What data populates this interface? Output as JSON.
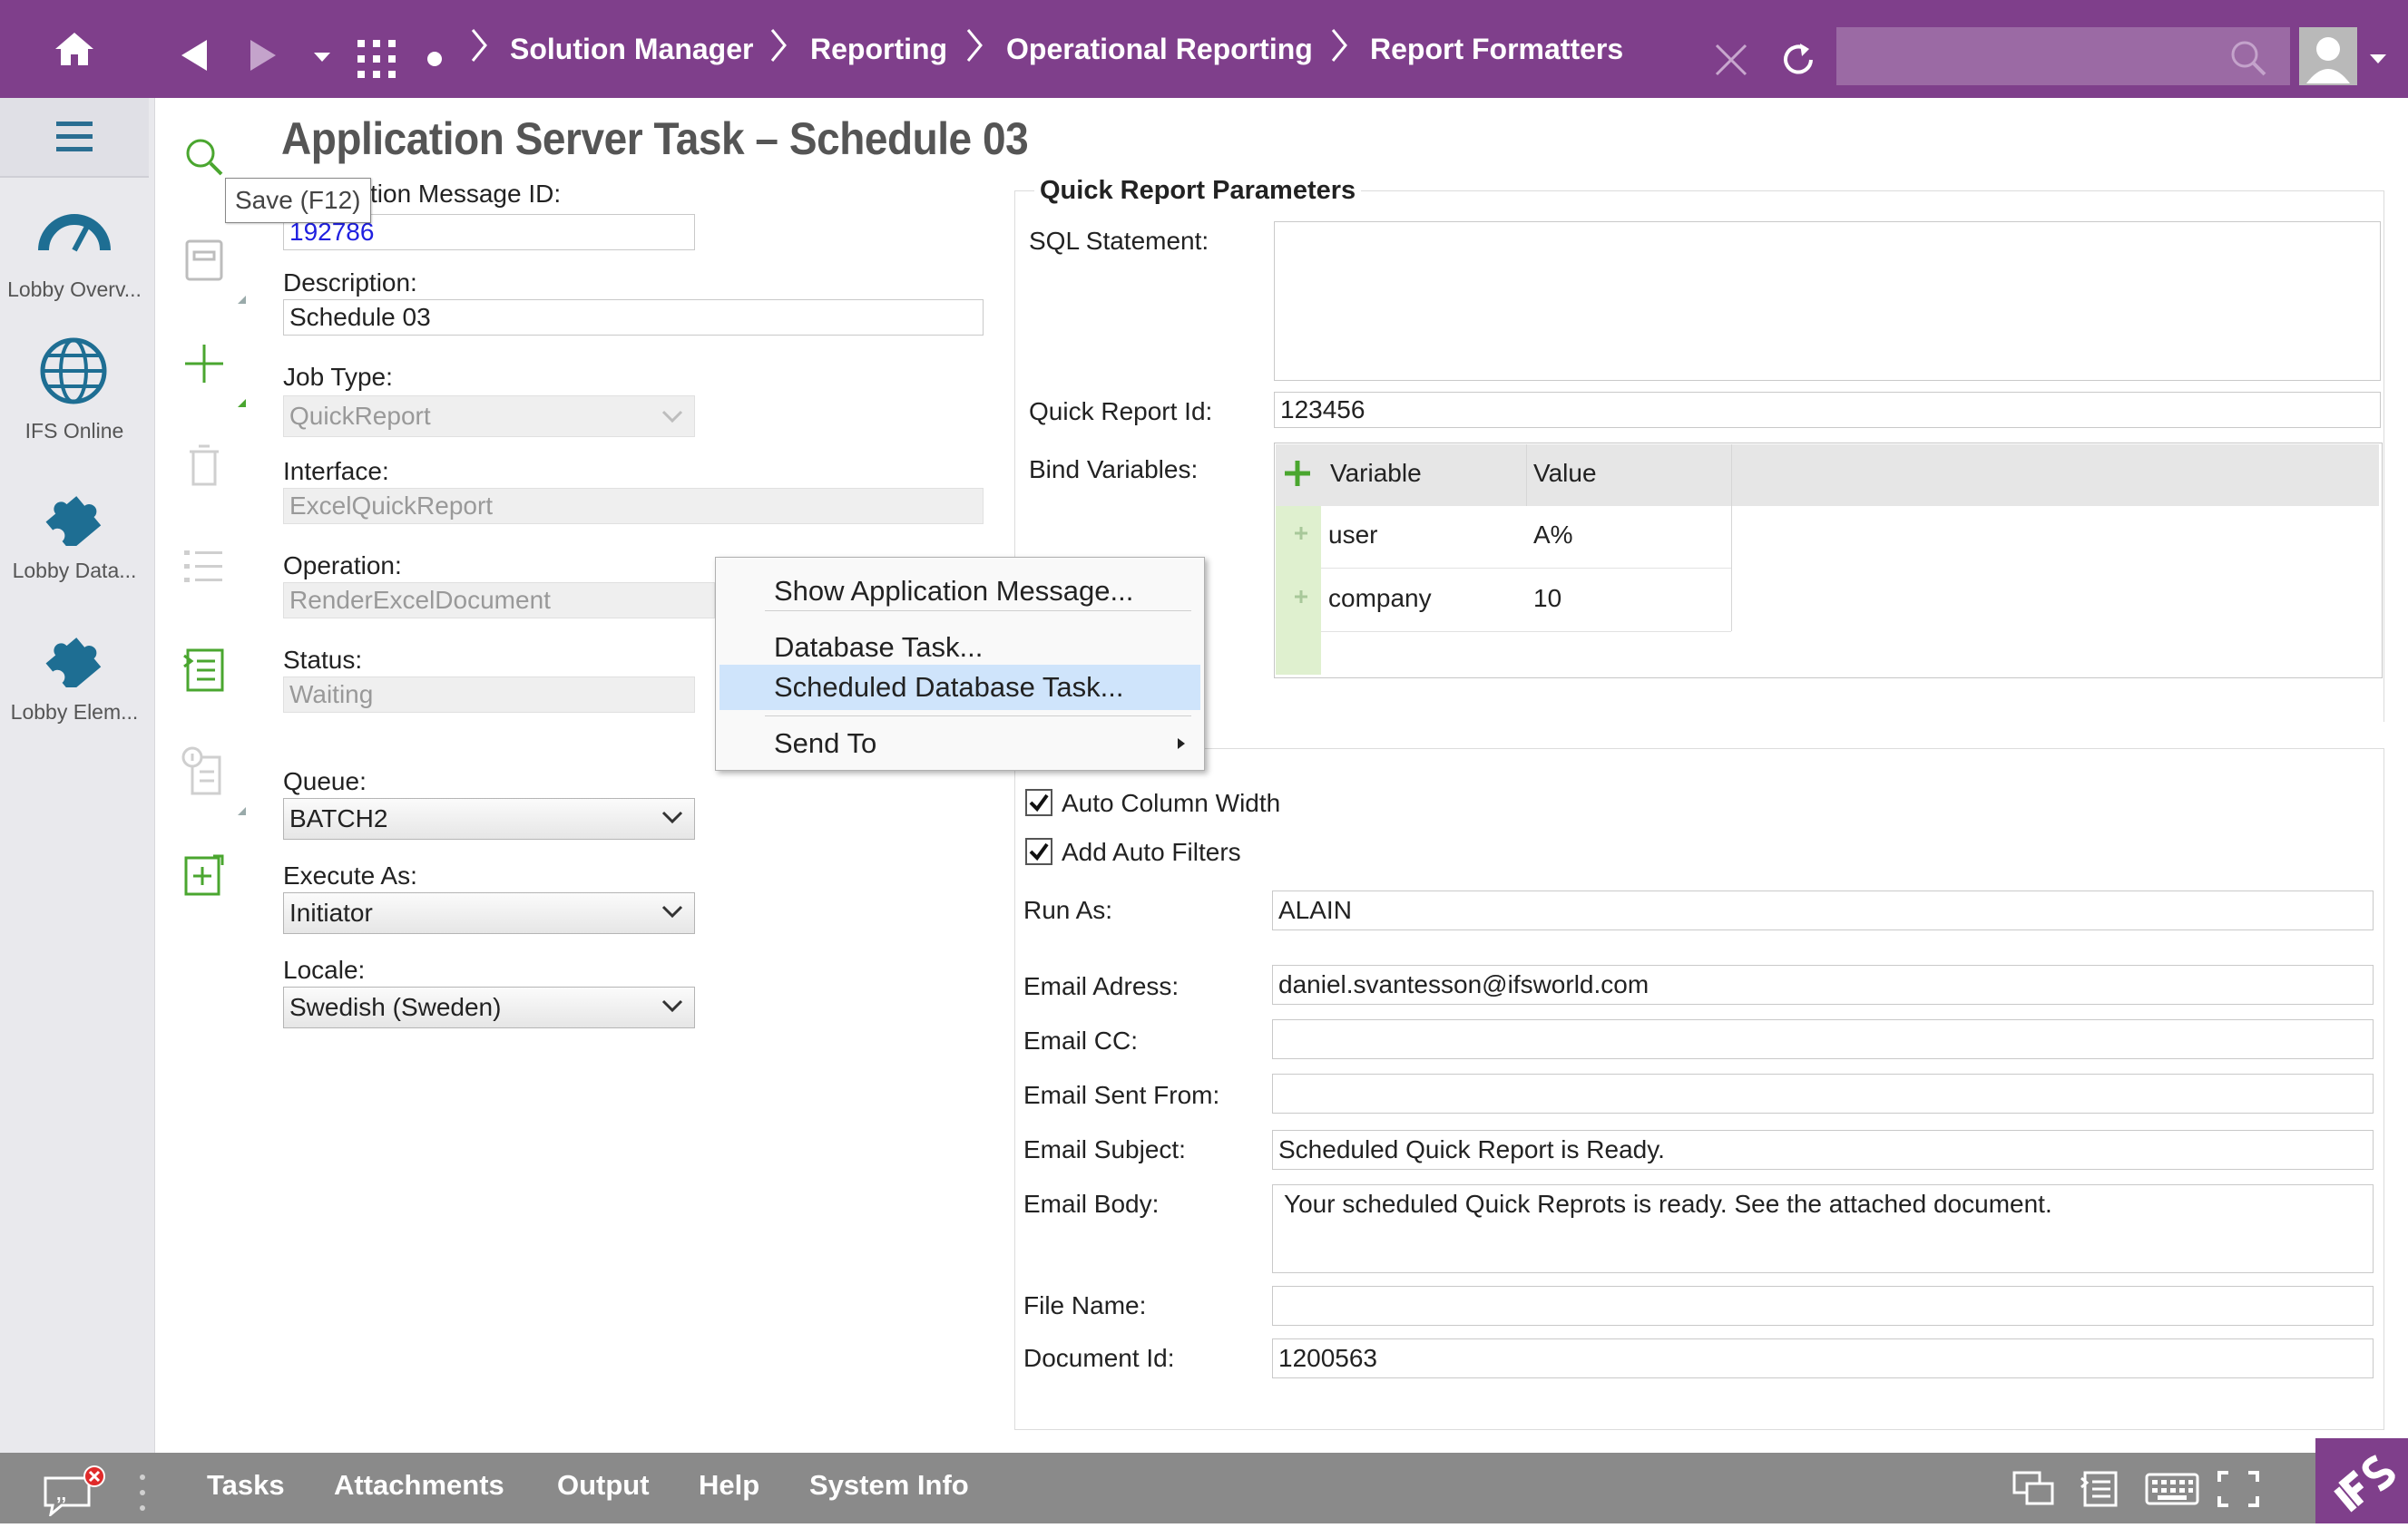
{
  "breadcrumbs": [
    "Solution Manager",
    "Reporting",
    "Operational Reporting",
    "Report Formatters"
  ],
  "sidebar": {
    "items": [
      {
        "label": "Lobby Overv..."
      },
      {
        "label": "IFS Online"
      },
      {
        "label": "Lobby Data..."
      },
      {
        "label": "Lobby Elem..."
      }
    ]
  },
  "tooltip": "Save (F12)",
  "page_title": "Application Server Task – Schedule 03",
  "form": {
    "message_id_label": "tion Message ID:",
    "message_id": "192786",
    "description_label": "Description:",
    "description": "Schedule 03",
    "job_type_label": "Job Type:",
    "job_type": "QuickReport",
    "interface_label": "Interface:",
    "interface": "ExcelQuickReport",
    "operation_label": "Operation:",
    "operation": "RenderExcelDocument",
    "status_label": "Status:",
    "status": "Waiting",
    "queue_label": "Queue:",
    "queue": "BATCH2",
    "execute_as_label": "Execute As:",
    "execute_as": "Initiator",
    "locale_label": "Locale:",
    "locale": "Swedish (Sweden)"
  },
  "quick_report": {
    "title": "Quick Report Parameters",
    "sql_label": "SQL Statement:",
    "sql": "",
    "id_label": "Quick Report Id:",
    "id": "123456",
    "bind_label": "Bind Variables:",
    "grid_headers": [
      "Variable",
      "Value"
    ],
    "grid_rows": [
      {
        "variable": "user",
        "value": "A%"
      },
      {
        "variable": "company",
        "value": "10"
      }
    ]
  },
  "options": {
    "auto_column_width": "Auto Column Width",
    "add_auto_filters": "Add Auto Filters",
    "run_as_label": "Run As:",
    "run_as": "ALAIN",
    "email_label": "Email Adress:",
    "email": "daniel.svantesson@ifsworld.com",
    "email_cc_label": "Email CC:",
    "email_cc": "",
    "email_from_label": "Email Sent From:",
    "email_from": "",
    "email_subject_label": "Email Subject:",
    "email_subject": "Scheduled Quick Report is Ready.",
    "email_body_label": "Email Body:",
    "email_body": "Your scheduled Quick Reprots is ready. See the attached document.",
    "file_name_label": "File Name:",
    "file_name": "",
    "document_id_label": "Document Id:",
    "document_id": "1200563"
  },
  "context_menu": {
    "items": [
      "Show Application Message...",
      "Database Task...",
      "Scheduled Database Task...",
      "Send To"
    ]
  },
  "bottombar": {
    "items": [
      "Tasks",
      "Attachments",
      "Output",
      "Help",
      "System Info"
    ]
  },
  "colors": {
    "brand": "#7f3f8b",
    "highlight": "#cfe4fb",
    "add_green": "#4aa62f",
    "icon_blue": "#1e6e93"
  }
}
